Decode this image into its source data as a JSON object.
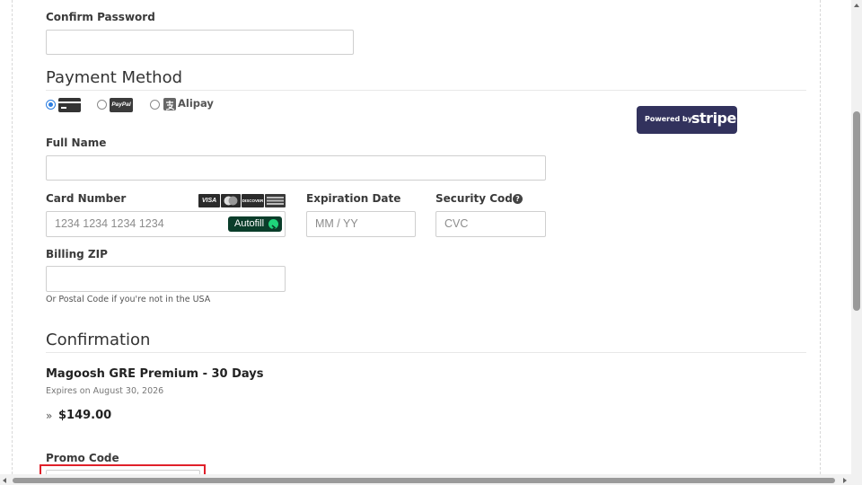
{
  "confirm_password": {
    "label": "Confirm Password",
    "value": ""
  },
  "payment": {
    "title": "Payment Method",
    "options": [
      {
        "name": "card",
        "selected": true
      },
      {
        "name": "PayPal",
        "selected": false
      },
      {
        "name": "Alipay",
        "selected": false
      }
    ],
    "powered_by": "Powered by",
    "stripe": "stripe"
  },
  "full_name": {
    "label": "Full Name",
    "value": ""
  },
  "card_number": {
    "label": "Card Number",
    "placeholder": "1234 1234 1234 1234",
    "autofill": "Autofill",
    "logos": [
      "VISA",
      "mastercard",
      "DISCOVER",
      "amex"
    ]
  },
  "expiration": {
    "label": "Expiration Date",
    "placeholder": "MM / YY"
  },
  "security": {
    "label": "Security Code",
    "placeholder": "CVC"
  },
  "billing_zip": {
    "label": "Billing ZIP",
    "value": "",
    "hint": "Or Postal Code if you're not in the USA"
  },
  "confirmation": {
    "title": "Confirmation",
    "product": "Magoosh GRE Premium - 30 Days",
    "expires": "Expires on August 30, 2026",
    "price_marker": "»",
    "price": "$149.00"
  },
  "promo": {
    "label": "Promo Code",
    "value": ""
  },
  "colors": {
    "stripe_badge": "#32325d",
    "autofill_bg": "#0a3d2a",
    "radio_selected": "#2a7de1",
    "highlight": "#e0202a"
  }
}
